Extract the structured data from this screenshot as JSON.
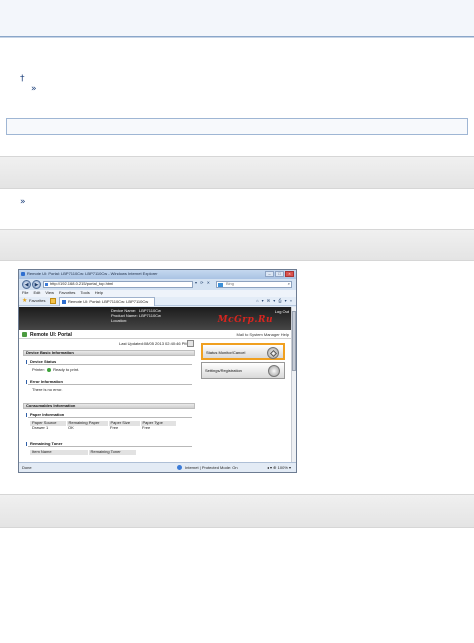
{
  "page": {
    "bullet_1": "†",
    "bullet_2": "»",
    "bullet_3": "»"
  },
  "browser": {
    "window_title": "Remote UI: Portal: LBP7110Cw: LBP7110Cw - Windows Internet Explorer",
    "window_buttons": [
      "–",
      "□",
      "×"
    ],
    "back_icon": "back-arrow-icon",
    "forward_icon": "forward-arrow-icon",
    "address": "http://192.168.0.215/portal_top.html",
    "address_buttons": "▾ ⟳ ✕",
    "search_placeholder": "Bing",
    "search_glyph": "⌕",
    "menu": [
      "File",
      "Edit",
      "View",
      "Favorites",
      "Tools",
      "Help"
    ],
    "favorites_label": "Favorites",
    "tab_title": "Remote UI: Portal: LBP7110Cw: LBP7110Cw",
    "command_bar": "⌂ ▾ ✉ ▾ ⎙ ▾ »",
    "status_left": "Done",
    "status_zone": "Internet | Protected Mode: On",
    "status_zoom": "◂ ▾ ⊕ 100% ▾"
  },
  "portal": {
    "device_name_key": "Device Name:",
    "device_name_val": "LBP7110Cw",
    "product_name_key": "Product Name:",
    "product_name_val": "LBP7110Cw",
    "location_key": "Location:",
    "logout": "Log Out",
    "watermark": "McGrp.Ru",
    "title": "Remote UI: Portal",
    "header_links": "Mail to System Manager  Help",
    "last_updated": "Last Updated:08/05 2013 02:40:46 PM",
    "sections": {
      "device_basic": "Device Basic Information",
      "device_status": "Device Status",
      "printer_label": "Printer:",
      "printer_status": "Ready to print.",
      "error_info": "Error Information",
      "error_text": "There is no error.",
      "consumables": "Consumables Information",
      "paper_info": "Paper Information",
      "remaining_toner": "Remaining Toner"
    },
    "paper_table": {
      "headers": [
        "Paper Source",
        "Remaining Paper",
        "Paper Size",
        "Paper Type"
      ],
      "row": [
        "Drawer 1",
        "OK",
        "Free",
        "Free"
      ]
    },
    "toner_table": {
      "headers": [
        "Item Name",
        "Remaining Toner"
      ]
    },
    "side_buttons": {
      "status_monitor": "Status Monitor/Cancel",
      "settings": "Settings/Registration"
    }
  }
}
